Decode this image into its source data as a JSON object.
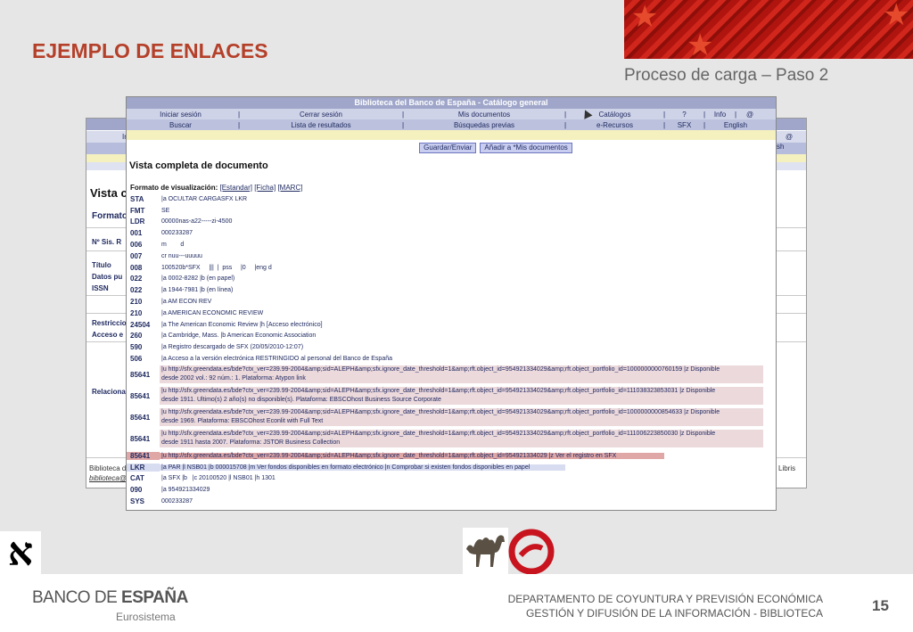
{
  "slide": {
    "title": "EJEMPLO DE ENLACES",
    "subtitle": "Proceso de carga – Paso 2",
    "page_number": "15",
    "bank_name_a": "BANCO DE ",
    "bank_name_b": "ESPAÑA",
    "bank_sub": "Eurosistema",
    "dept_line1": "DEPARTAMENTO DE COYUNTURA Y PREVISIÓN ECONÓMICA",
    "dept_line2": "GESTIÓN Y DIFUSIÓN DE LA INFORMACIÓN - BIBLIOTECA",
    "aleph_glyph": "א"
  },
  "bg_window": {
    "frag_in": "In",
    "frag_at": "@",
    "frag_sh": "sh",
    "heading": "Vista c",
    "format": "Formato",
    "labels": [
      "Nº Sis. R",
      "Título",
      "Datos pu",
      "ISSN",
      "Restriccio",
      "Acceso e",
      "Relaciona"
    ],
    "footer_line1": "Biblioteca d",
    "footer_line2": "biblioteca@",
    "footer_right": "Libris"
  },
  "catalog": {
    "window_title": "Biblioteca del Banco de España - Catálogo general",
    "nav1": [
      "Iniciar sesión",
      "Cerrar sesión",
      "Mis documentos",
      "Catálogos",
      "?",
      "Info",
      "@"
    ],
    "nav2": [
      "Buscar",
      "Lista de resultados",
      "Búsquedas previas",
      "e-Recursos",
      "SFX",
      "English"
    ],
    "buttons": {
      "save": "Guardar/Enviar",
      "add": "Añadir a *Mis documentos"
    },
    "doc_title": "Vista completa de documento",
    "format_label": "Formato de visualización:",
    "formats": [
      "[Estandar]",
      "[Ficha]",
      "[MARC]"
    ],
    "records": [
      {
        "tag": "STA",
        "value": "|a OCULTAR CARGASFX LKR"
      },
      {
        "tag": "FMT",
        "value": "SE"
      },
      {
        "tag": "LDR",
        "value": "00000nas-a22-----zi-4500"
      },
      {
        "tag": "001",
        "value": "000233287"
      },
      {
        "tag": "006",
        "value": "m        d"
      },
      {
        "tag": "007",
        "value": "cr nuu---uuuuu"
      },
      {
        "tag": "008",
        "value": "100520b*SFX     |||  |  pss     |0     |eng d"
      },
      {
        "tag": "022",
        "value": "|a 0002-8282 |b (en papel)"
      },
      {
        "tag": "022",
        "value": "|a 1944-7981 |b (en línea)"
      },
      {
        "tag": "210",
        "value": "|a AM ECON REV"
      },
      {
        "tag": "210",
        "value": "|a AMERICAN ECONOMIC REVIEW"
      },
      {
        "tag": "24504",
        "value": "|a The American Economic Review |h [Acceso electrónico]"
      },
      {
        "tag": "260",
        "value": "|a Cambridge, Mass. |b American Economic Association"
      },
      {
        "tag": "590",
        "value": "|a Registro descargado de SFX (20/05/2010-12:07)"
      },
      {
        "tag": "506",
        "value": "|a Acceso a la versión electrónica RESTRINGIDO al personal del Banco de España"
      }
    ],
    "links": [
      {
        "tag": "85641",
        "line1": "|u http://sfx.greendata.es/bde?ctx_ver=239.99-2004&amp;sid=ALEPH&amp;sfx.ignore_date_threshold=1&amp;rft.object_id=954921334029&amp;rft.object_portfolio_id=1000000000760159 |z Disponible",
        "line2": "desde 2002 vol.: 92 núm.: 1. Plataforma: Atypon link"
      },
      {
        "tag": "85641",
        "line1": "|u http://sfx.greendata.es/bde?ctx_ver=239.99-2004&amp;sid=ALEPH&amp;sfx.ignore_date_threshold=1&amp;rft.object_id=954921334029&amp;rft.object_portfolio_id=111038323853031 |z Disponible",
        "line2": "desde 1911. Ultimo(s) 2 año(s) no disponible(s). Plataforma: EBSCOhost Business Source Corporate"
      },
      {
        "tag": "85641",
        "line1": "|u http://sfx.greendata.es/bde?ctx_ver=239.99-2004&amp;sid=ALEPH&amp;sfx.ignore_date_threshold=1&amp;rft.object_id=954921334029&amp;rft.object_portfolio_id=1000000000854633 |z Disponible",
        "line2": "desde 1969. Plataforma: EBSCOhost Econlit with Full Text"
      },
      {
        "tag": "85641",
        "line1": "|u http://sfx.greendata.es/bde?ctx_ver=239.99-2004&amp;sid=ALEPH&amp;sfx.ignore_date_threshold=1&amp;rft.object_id=954921334029&amp;rft.object_portfolio_id=111006223850030 |z Disponible",
        "line2": "desde 1911 hasta 2007. Plataforma: JSTOR Business Collection"
      }
    ],
    "red_link": {
      "tag": "85641",
      "value": "|u http://sfx.greendata.es/bde?ctx_ver=239.99-2004&amp;sid=ALEPH&amp;sfx.ignore_date_threshold=1&amp;rft.object_id=954921334029 |z Ver el registro en SFX"
    },
    "lkr": {
      "tag": "LKR",
      "value": "|a PAR |l NSB01 |b 000015708 |m Ver fondos disponibles en formato electrónico |n Comprobar si existen fondos disponibles en papel"
    },
    "tail": [
      {
        "tag": "CAT",
        "value": "|a SFX |b   |c 20100520 |l NSB01 |h 1301"
      },
      {
        "tag": "090",
        "value": "|a 954921334029"
      },
      {
        "tag": "SYS",
        "value": "000233287"
      }
    ]
  }
}
